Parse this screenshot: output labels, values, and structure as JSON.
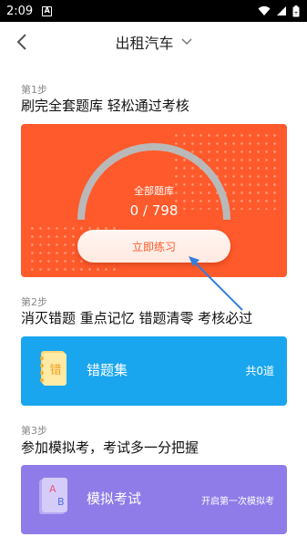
{
  "status_bar": {
    "time": "2:09",
    "notification_icon": "A",
    "icons": [
      "wifi-icon",
      "signal-icon",
      "battery-icon"
    ]
  },
  "nav": {
    "title": "出租汽车",
    "back_icon": "chevron-left-icon",
    "dropdown_icon": "chevron-down-icon"
  },
  "steps": [
    {
      "label": "第1步",
      "title": "刷完全套题库 轻松通过考核",
      "card": {
        "gauge_label": "全部题库",
        "count": "0 / 798",
        "progress_done": 0,
        "progress_total": 798,
        "button_label": "立即练习",
        "color": "#ff5a2b"
      }
    },
    {
      "label": "第2步",
      "title": "消灭错题 重点记忆 错题清零 考核必过",
      "card": {
        "icon_text": "错",
        "title": "错题集",
        "right_text": "共0道",
        "color": "#1aa6ee"
      }
    },
    {
      "label": "第3步",
      "title": "参加模拟考，考试多一分把握",
      "card": {
        "icon_text_a": "A",
        "icon_text_b": "B",
        "title": "模拟考试",
        "right_text": "开启第一次模拟考",
        "color": "#8f7ce8"
      }
    }
  ]
}
